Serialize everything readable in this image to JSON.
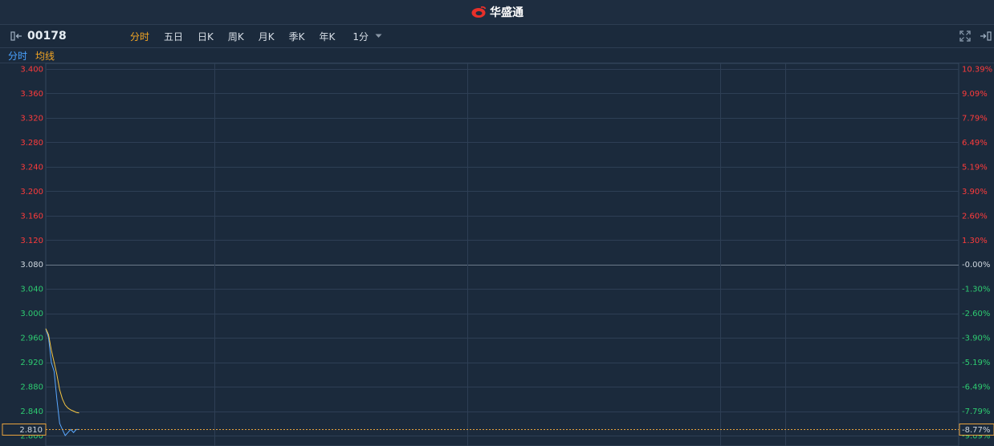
{
  "header": {
    "brand": "华盛通"
  },
  "toolbar": {
    "code": "00178",
    "tabs": [
      "分时",
      "五日",
      "日K",
      "周K",
      "月K",
      "季K",
      "年K"
    ],
    "active_tab": "分时",
    "period": "1分"
  },
  "subbar": {
    "left": "分时",
    "right": "均线"
  },
  "colors": {
    "background": "#1b2a3c",
    "grid": "#2e3f55",
    "up": "#ff3b3b",
    "down": "#2ecc71",
    "base": "#d0d8e0",
    "price_line": "#5aa8ff",
    "avg_line": "#f5c542",
    "current": "#e8a33d"
  },
  "chart_data": {
    "type": "line",
    "prev_close": 3.08,
    "ylim": [
      2.8,
      3.4
    ],
    "left_ticks": [
      "3.400",
      "3.360",
      "3.320",
      "3.280",
      "3.240",
      "3.200",
      "3.160",
      "3.120",
      "3.080",
      "3.040",
      "3.000",
      "2.960",
      "2.920",
      "2.880",
      "2.840",
      "2.800"
    ],
    "left_tick_values": [
      3.4,
      3.36,
      3.32,
      3.28,
      3.24,
      3.2,
      3.16,
      3.12,
      3.08,
      3.04,
      3.0,
      2.96,
      2.92,
      2.88,
      2.84,
      2.8
    ],
    "right_ticks": [
      "10.39%",
      "9.09%",
      "7.79%",
      "6.49%",
      "5.19%",
      "3.90%",
      "2.60%",
      "1.30%",
      "-0.00%",
      "-1.30%",
      "-2.60%",
      "-3.90%",
      "-5.19%",
      "-6.49%",
      "-7.79%",
      "-9.09%"
    ],
    "current_price": "2.810",
    "current_pct": "-8.77%",
    "current_value": 2.81,
    "series": [
      {
        "values": [
          2.975,
          2.96,
          2.92,
          2.905,
          2.86,
          2.82,
          2.81,
          2.8,
          2.805,
          2.81,
          2.805,
          2.81,
          2.81
        ]
      },
      {
        "values": [
          2.975,
          2.965,
          2.94,
          2.92,
          2.9,
          2.875,
          2.86,
          2.85,
          2.845,
          2.842,
          2.84,
          2.838,
          2.837
        ]
      }
    ],
    "total_points": 330,
    "session_dividers": [
      0.1845,
      0.4615,
      0.4615,
      0.7385
    ]
  }
}
